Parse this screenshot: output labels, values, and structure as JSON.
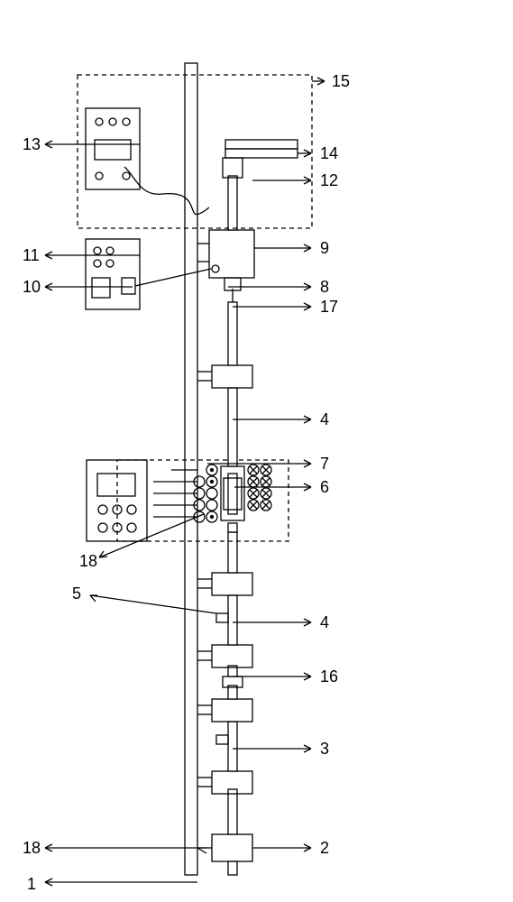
{
  "labels": {
    "n1": "1",
    "n2": "2",
    "n3": "3",
    "n4": "4",
    "n5": "5",
    "n6": "6",
    "n7": "7",
    "n8": "8",
    "n9": "9",
    "n10": "10",
    "n11": "11",
    "n12": "12",
    "n13": "13",
    "n14": "14",
    "n15": "15",
    "n16": "16",
    "n17": "17",
    "n18a": "18",
    "n18b": "18"
  }
}
